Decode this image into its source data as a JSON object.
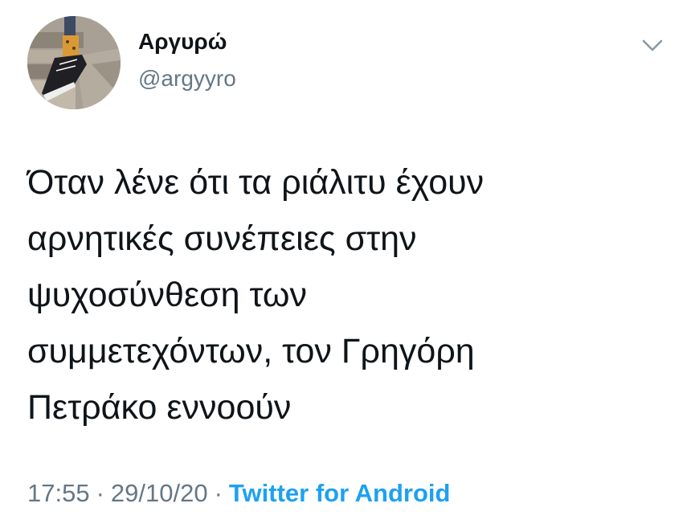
{
  "tweet": {
    "display_name": "Αργυρώ",
    "handle": "@argyyro",
    "text": "Όταν λένε ότι τα ριάλιτυ έχουν\nαρνητικές συνέπειες στην\nψυχοσύνθεση των\nσυμμετεχόντων, τον Γρηγόρη\nΠετράκο εννοούν",
    "time": "17:55",
    "date": "29/10/20",
    "separator": "·",
    "source": "Twitter for Android"
  },
  "icons": {
    "menu": "chevron-down-icon",
    "avatar": "avatar-photo"
  },
  "colors": {
    "text": "#0f1419",
    "secondary": "#657786",
    "link": "#1da1f2",
    "background": "#ffffff"
  }
}
